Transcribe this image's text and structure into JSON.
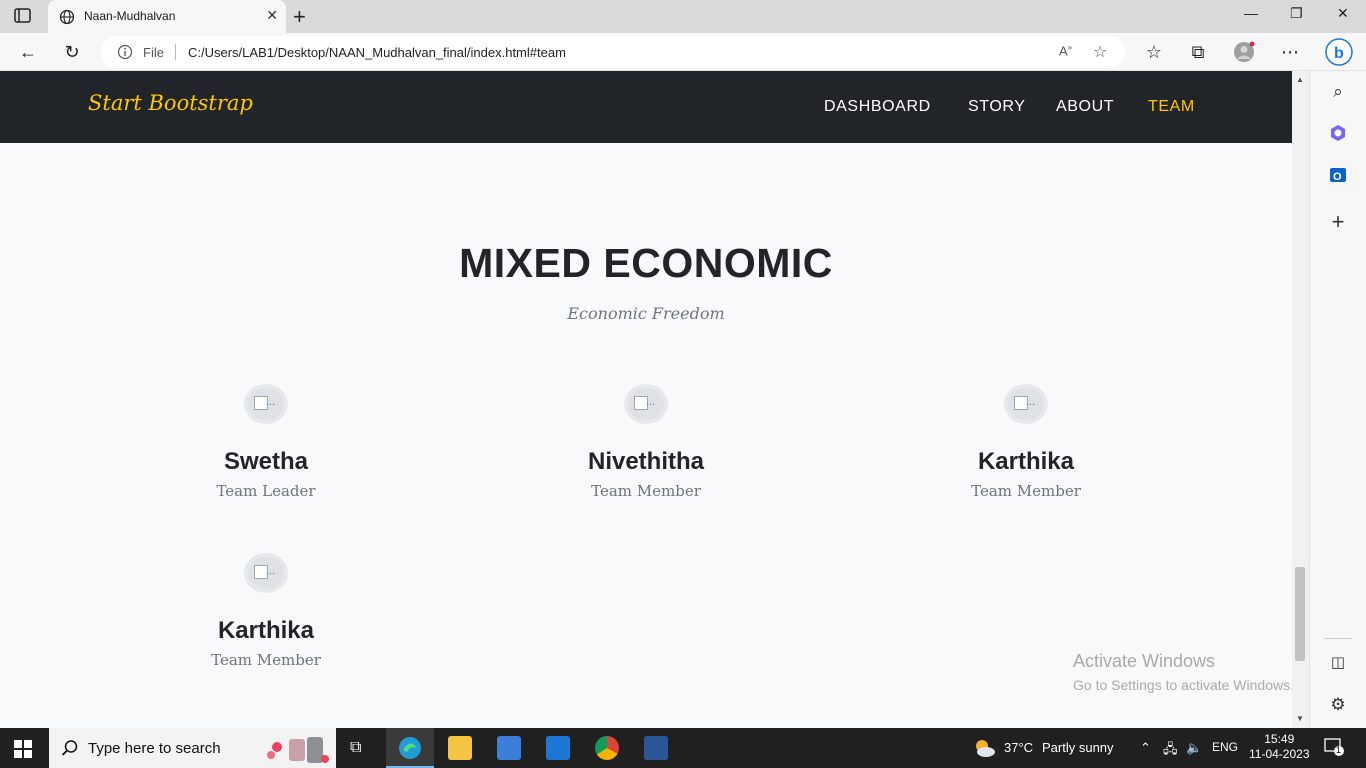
{
  "browser": {
    "tab_title": "Naan-Mudhalvan",
    "address_scheme": "File",
    "address_url": "C:/Users/LAB1/Desktop/NAAN_Mudhalvan_final/index.html#team"
  },
  "navbar": {
    "brand": "Start Bootstrap",
    "links": [
      "DASHBOARD",
      "STORY",
      "ABOUT",
      "TEAM"
    ],
    "active": "TEAM",
    "accent_color": "#ffc800"
  },
  "section": {
    "heading": "MIXED ECONOMIC",
    "subheading": "Economic Freedom"
  },
  "team": [
    {
      "name": "Swetha",
      "role": "Team Leader",
      "img_alt": "..."
    },
    {
      "name": "Nivethitha",
      "role": "Team Member",
      "img_alt": "..."
    },
    {
      "name": "Karthika",
      "role": "Team Member",
      "img_alt": "..."
    },
    {
      "name": "Karthika",
      "role": "Team Member",
      "img_alt": "..."
    }
  ],
  "watermark": {
    "title": "Activate Windows",
    "subtitle": "Go to Settings to activate Windows."
  },
  "taskbar": {
    "search_placeholder": "Type here to search",
    "weather": "37°C",
    "weather_desc": "Partly sunny",
    "language": "ENG",
    "time": "15:49",
    "date": "11-04-2023",
    "notification_count": "1"
  }
}
